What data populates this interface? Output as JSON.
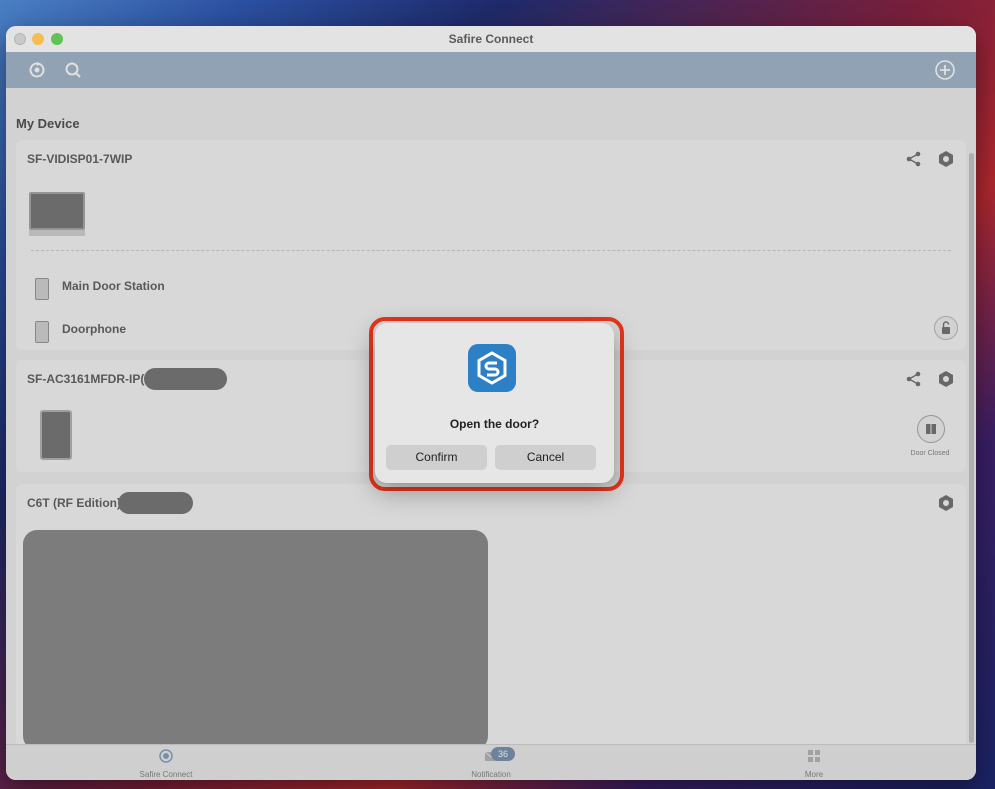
{
  "window": {
    "title": "Safire Connect"
  },
  "toolbar": {
    "left_icons": [
      "refresh-icon",
      "search-icon"
    ],
    "right_icon": "add-icon"
  },
  "content": {
    "section_title": "My Device",
    "devices": [
      {
        "name": "SF-VIDISP01-7WIP",
        "sub_items": [
          {
            "label": "Main Door Station"
          },
          {
            "label": "Doorphone"
          }
        ]
      },
      {
        "name": "SF-AC3161MFDR-IP(",
        "door_status": "Door Closed"
      },
      {
        "name": "C6T (RF Edition)"
      }
    ]
  },
  "tabs": [
    {
      "label": "Safire Connect",
      "icon": "safire-icon"
    },
    {
      "label": "Notification",
      "icon": "envelope-icon",
      "badge": "36"
    },
    {
      "label": "More",
      "icon": "grid-icon"
    }
  ],
  "dialog": {
    "message": "Open the door?",
    "confirm": "Confirm",
    "cancel": "Cancel"
  },
  "colors": {
    "accent": "#2d7fc6",
    "highlight": "#e8361c",
    "toolbar": "#a6b9cf"
  }
}
